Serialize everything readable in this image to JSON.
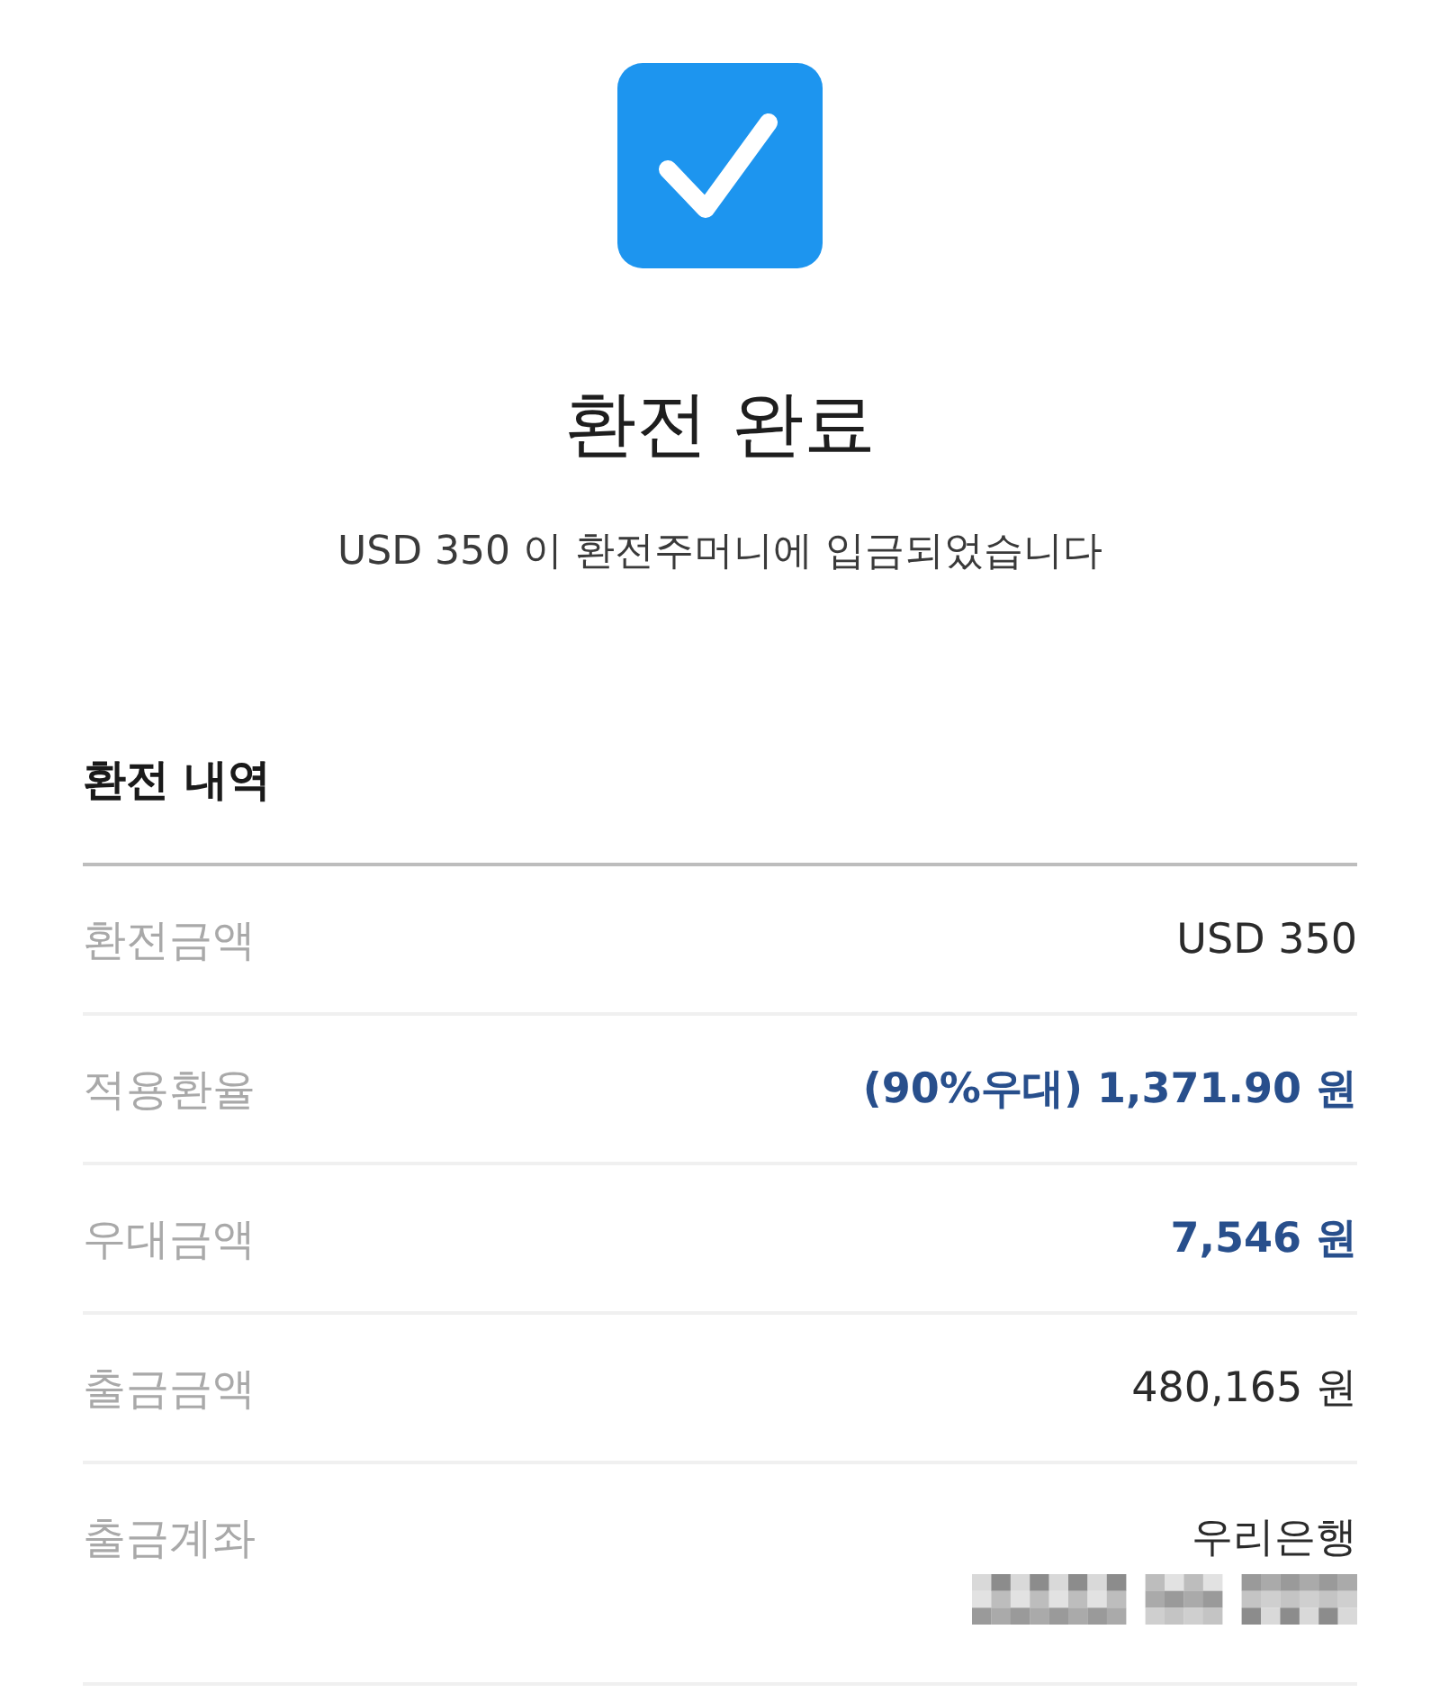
{
  "title": "환전 완료",
  "message": "USD 350 이 환전주머니에 입금되었습니다",
  "section": {
    "title": "환전 내역",
    "rows": [
      {
        "label": "환전금액",
        "value": "USD 350",
        "highlighted": false,
        "masked_detail": false
      },
      {
        "label": "적용환율",
        "value": "(90%우대) 1,371.90 원",
        "highlighted": true,
        "masked_detail": false
      },
      {
        "label": "우대금액",
        "value": "7,546 원",
        "highlighted": true,
        "masked_detail": false
      },
      {
        "label": "출금금액",
        "value": "480,165 원",
        "highlighted": false,
        "masked_detail": false
      },
      {
        "label": "출금계좌",
        "value": "우리은행",
        "highlighted": false,
        "masked_detail": true
      }
    ]
  }
}
